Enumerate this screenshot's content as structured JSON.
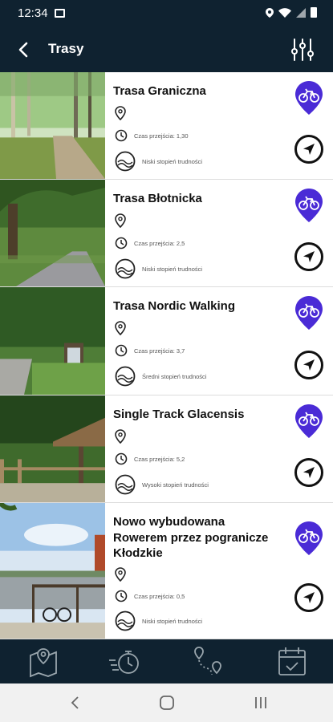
{
  "status_bar": {
    "time": "12:34"
  },
  "app_bar": {
    "title": "Trasy"
  },
  "routes": [
    {
      "name": "Trasa Graniczna",
      "time_label": "Czas przejścia: 1,30",
      "difficulty": "Niski stopień trudności"
    },
    {
      "name": "Trasa Błotnicka",
      "time_label": "Czas przejścia: 2,5",
      "difficulty": "Niski stopień trudności"
    },
    {
      "name": "Trasa Nordic Walking",
      "time_label": "Czas przejścia: 3,7",
      "difficulty": "Średni stopień trudności"
    },
    {
      "name": "Single Track Glacensis",
      "time_label": "Czas przejścia: 5,2",
      "difficulty": "Wysoki stopień trudności"
    },
    {
      "name": "Nowo wybudowana Rowerem przez pogranicze Kłodzkie",
      "time_label": "Czas przejścia: 0,5",
      "difficulty": "Niski stopień trudności"
    }
  ],
  "colors": {
    "header_bg": "#0f2230",
    "accent_purple": "#4a2bd6",
    "system_nav_bg": "#f1f1f1"
  },
  "icons": {
    "bottom_nav": [
      "map-pin-icon",
      "stopwatch-icon",
      "route-icon",
      "calendar-check-icon"
    ],
    "route_type": "bicycle-pin-icon"
  }
}
